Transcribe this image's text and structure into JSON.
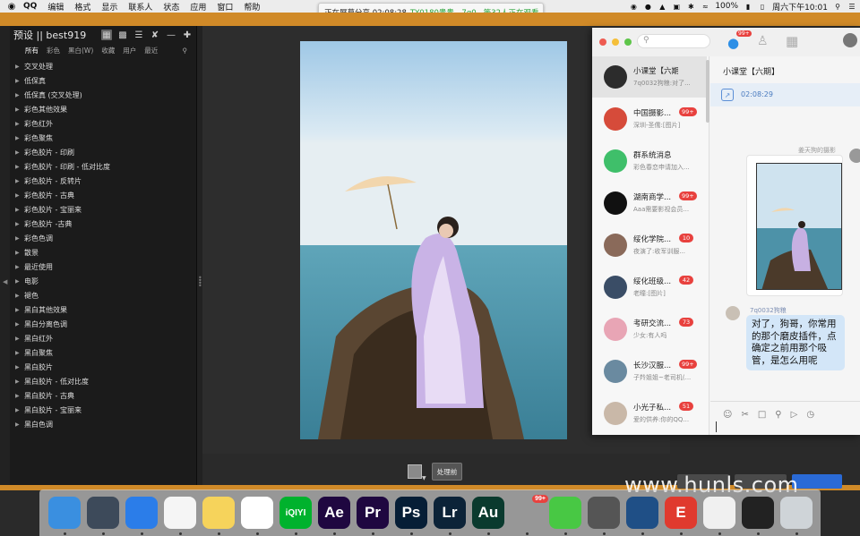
{
  "menubar": {
    "apple": "",
    "app": "QQ",
    "items": [
      "编辑",
      "格式",
      "显示",
      "联系人",
      "状态",
      "应用",
      "窗口",
      "帮助"
    ],
    "battery": "100%",
    "clock": "周六下午10:01"
  },
  "share_banner": {
    "text": "正在屏幕分享 02:08:28",
    "green": "TY0180贵贵、7q0...等32人正在观看"
  },
  "preset_panel": {
    "title": "预设 || best919",
    "tabs": [
      "所有",
      "彩色",
      "黑白(W)",
      "收藏",
      "用户",
      "最近"
    ],
    "items": [
      "交叉处理",
      "低保真",
      "低保真 (交叉处理)",
      "彩色其他效果",
      "彩色红外",
      "彩色聚焦",
      "彩色胶片 - 印刷",
      "彩色胶片 - 印刷 - 低对比度",
      "彩色胶片 - 反转片",
      "彩色胶片 - 古典",
      "彩色胶片 - 宝丽来",
      "彩色胶片 -古典",
      "彩色色调",
      "散景",
      "最近使用",
      "电影",
      "褪色",
      "黑白其他效果",
      "黑白分离色调",
      "黑白红外",
      "黑白聚焦",
      "黑白胶片",
      "黑白胶片 - 低对比度",
      "黑白胶片 - 古典",
      "黑白胶片 - 宝丽来",
      "黑白色调"
    ]
  },
  "viewer": {
    "before_button": "处理前"
  },
  "qq": {
    "unread_badge": "99+",
    "conversations": [
      {
        "name": "小课堂【六期】",
        "preview": "7q0032狗粮:对了...",
        "badge": "",
        "color": "#2c2c2c"
      },
      {
        "name": "中国摄影...",
        "preview": "深圳-圣儒:[图片]",
        "badge": "99+",
        "color": "#d64b3a"
      },
      {
        "name": "群系统消息",
        "preview": "彩色春恋申请加入...",
        "badge": "",
        "color": "#3fbf6a"
      },
      {
        "name": "湖南商学...",
        "preview": "Aaa需要影视会员...",
        "badge": "99+",
        "color": "#111111"
      },
      {
        "name": "绥化学院...",
        "preview": "夜演了:收军训服...",
        "badge": "10",
        "color": "#8a6a5a"
      },
      {
        "name": "绥化班级...",
        "preview": "老瞳:[图片]",
        "badge": "42",
        "color": "#3a4d66"
      },
      {
        "name": "考研交流...",
        "preview": "少女:有人吗",
        "badge": "73",
        "color": "#e8a5b5"
      },
      {
        "name": "长沙汉服...",
        "preview": "子羚姐姐~老司机(...",
        "badge": "99+",
        "color": "#6a8aa0"
      },
      {
        "name": "小光子私...",
        "preview": "爱的供养:你的QQ...",
        "badge": "51",
        "color": "#c9b8a8"
      }
    ],
    "chat": {
      "title": "小课堂【六期】",
      "share_time": "02:08:29",
      "sender1": "姜天狗的摄影",
      "sender2": "7q0032狗粮",
      "message": "对了，狗哥，你常用的那个磨皮插件，点确定之前用那个吸管，是怎么用呢"
    }
  },
  "watermark": "www.hunls.com",
  "dock": {
    "apps": [
      {
        "name": "finder",
        "label": "",
        "bg": "#3a8fe0"
      },
      {
        "name": "launchpad",
        "label": "",
        "bg": "#3d4a5a"
      },
      {
        "name": "safari",
        "label": "",
        "bg": "#2b7de9"
      },
      {
        "name": "reminders",
        "label": "",
        "bg": "#f5f5f5"
      },
      {
        "name": "notes",
        "label": "",
        "bg": "#f6d35b"
      },
      {
        "name": "photos",
        "label": "",
        "bg": "#ffffff"
      },
      {
        "name": "iqiyi",
        "label": "iQIYI",
        "bg": "#00b22d"
      },
      {
        "name": "after-effects",
        "label": "Ae",
        "bg": "#1f0740"
      },
      {
        "name": "premiere",
        "label": "Pr",
        "bg": "#1f0740"
      },
      {
        "name": "photoshop",
        "label": "Ps",
        "bg": "#061e36"
      },
      {
        "name": "lightroom",
        "label": "Lr",
        "bg": "#0c2338"
      },
      {
        "name": "audition",
        "label": "Au",
        "bg": "#0a3a2e"
      },
      {
        "name": "qq",
        "label": "",
        "bg": "transparent",
        "badge": "99+"
      },
      {
        "name": "wechat",
        "label": "",
        "bg": "#48c844"
      },
      {
        "name": "capture",
        "label": "",
        "bg": "#555555"
      },
      {
        "name": "quicktime",
        "label": "",
        "bg": "#1f4f86"
      },
      {
        "name": "e-app",
        "label": "E",
        "bg": "#e03a2e"
      },
      {
        "name": "xmp-file",
        "label": "",
        "bg": "#f0f0f0"
      },
      {
        "name": "screen-file",
        "label": "",
        "bg": "#222222"
      },
      {
        "name": "trash",
        "label": "",
        "bg": "#cfd4d8"
      }
    ]
  }
}
